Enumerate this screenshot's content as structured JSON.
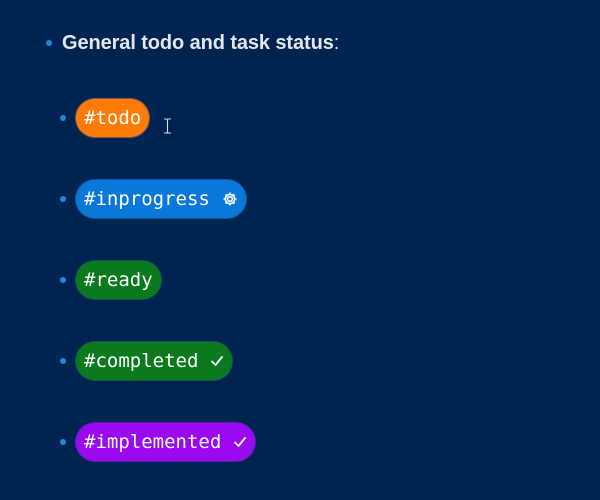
{
  "heading": {
    "text": "General todo and task status",
    "suffix": ":"
  },
  "tags": [
    {
      "label": "#todo",
      "color": "#ff7b08",
      "icon": ""
    },
    {
      "label": "#inprogress",
      "color": "#0a78d8",
      "icon": "gear-icon"
    },
    {
      "label": "#ready",
      "color": "#0b7a1e",
      "icon": ""
    },
    {
      "label": "#completed",
      "color": "#0b7a1e",
      "icon": "check-icon"
    },
    {
      "label": "#implemented",
      "color": "#9a09f0",
      "icon": "check-icon"
    }
  ],
  "colors": {
    "background": "#002451",
    "bullet": "#1a8ae0",
    "heading_text": "#e3e6ea"
  }
}
